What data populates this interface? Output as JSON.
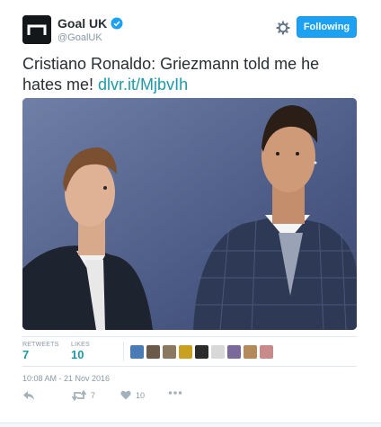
{
  "account": {
    "display_name": "Goal UK",
    "handle": "@GoalUK",
    "verified": true,
    "avatar_icon": "goal-logo-icon"
  },
  "header": {
    "settings_icon": "gear-icon",
    "follow_label": "Following"
  },
  "tweet": {
    "text": "Cristiano Ronaldo: Griezmann told me he hates me! ",
    "link_text": "dlvr.it/MjbvIh"
  },
  "media": {
    "description_icon": "photo-two-footballers"
  },
  "stats": {
    "retweets_label": "RETWEETS",
    "retweets_value": "7",
    "likes_label": "LIKES",
    "likes_value": "10",
    "liker_avatars": [
      "#4b7bb5",
      "#6b5a4a",
      "#8a7860",
      "#c9a020",
      "#2b2b2b",
      "#d8d8d8",
      "#7a6a9c",
      "#b58a5a",
      "#c98a8a"
    ]
  },
  "timestamp": "10:08 AM - 21 Nov 2016",
  "actions": {
    "reply_icon": "reply-icon",
    "retweet_icon": "retweet-icon",
    "retweet_count": "7",
    "like_icon": "heart-icon",
    "like_count": "10",
    "more_icon": "more-icon"
  },
  "colors": {
    "accent": "#1da1f2",
    "link": "#1d9aa8",
    "muted": "#8899a6"
  }
}
